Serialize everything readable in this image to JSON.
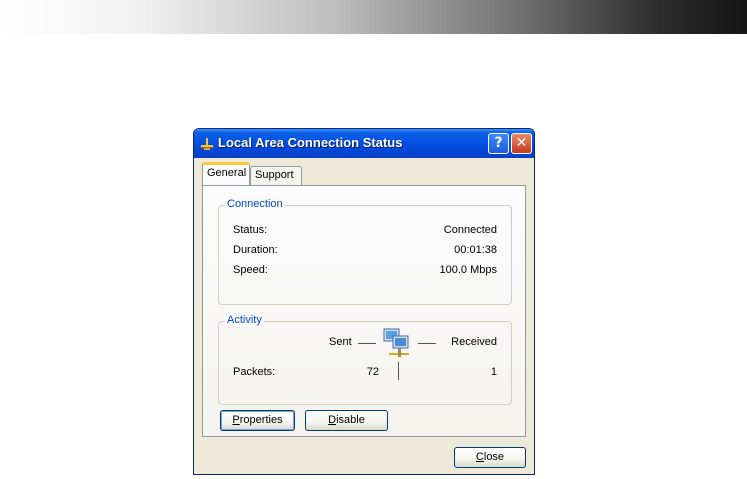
{
  "window": {
    "title": "Local Area Connection Status",
    "help_label": "?",
    "close_label": "✕"
  },
  "tabs": [
    {
      "label": "General",
      "active": true
    },
    {
      "label": "Support",
      "active": false
    }
  ],
  "connection": {
    "legend": "Connection",
    "rows": [
      {
        "label": "Status:",
        "value": "Connected"
      },
      {
        "label": "Duration:",
        "value": "00:01:38"
      },
      {
        "label": "Speed:",
        "value": "100.0 Mbps"
      }
    ]
  },
  "activity": {
    "legend": "Activity",
    "sent_label": "Sent",
    "received_label": "Received",
    "packets_label": "Packets:",
    "packets_sent": "72",
    "packets_received": "1"
  },
  "buttons": {
    "properties_mnemonic": "P",
    "properties_rest": "roperties",
    "disable_mnemonic": "D",
    "disable_rest": "isable",
    "close_mnemonic": "C",
    "close_rest": "lose"
  },
  "colors": {
    "titlebar": "#0554e3",
    "dialog_bg": "#ece9d8",
    "group_legend": "#0046d5",
    "active_tab_accent": "#ffc83c"
  }
}
